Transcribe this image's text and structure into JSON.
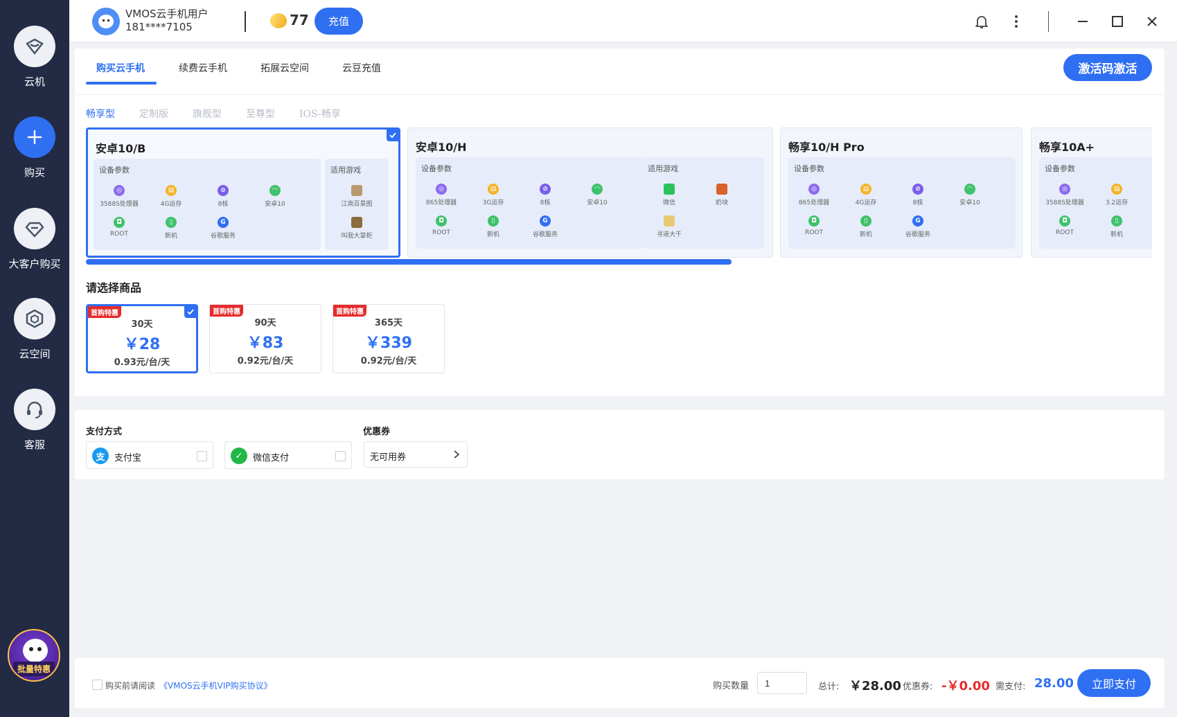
{
  "sidebar": {
    "items": [
      {
        "label": "云机",
        "icon": "cloud-phone-icon"
      },
      {
        "label": "购买",
        "icon": "plus-icon"
      },
      {
        "label": "大客户购买",
        "icon": "diamond-icon"
      },
      {
        "label": "云空间",
        "icon": "cube-icon"
      },
      {
        "label": "客服",
        "icon": "headset-icon"
      }
    ],
    "promo_label": "批量特惠"
  },
  "header": {
    "user_name": "VMOS云手机用户",
    "user_phone": "181****7105",
    "bean_count": "77",
    "recharge_label": "充值"
  },
  "tabs": [
    {
      "label": "购买云手机"
    },
    {
      "label": "续费云手机"
    },
    {
      "label": "拓展云空间"
    },
    {
      "label": "云豆充值"
    }
  ],
  "activate_label": "激活码激活",
  "subtabs": [
    {
      "label": "畅享型"
    },
    {
      "label": "定制版"
    },
    {
      "label": "旗舰型"
    },
    {
      "label": "至尊型"
    },
    {
      "label": "IOS-畅享"
    }
  ],
  "products": [
    {
      "title": "安卓10/B",
      "spec_title": "设备参数",
      "specs": [
        "3588S处理器",
        "4G运存",
        "8核",
        "安卓10",
        "ROOT",
        "新机",
        "谷歌服务"
      ],
      "games_title": "适用游戏",
      "games": [
        "江南百景图",
        "叫我大掌柜"
      ]
    },
    {
      "title": "安卓10/H",
      "spec_title": "设备参数",
      "specs": [
        "865处理器",
        "3G运存",
        "8核",
        "安卓10",
        "ROOT",
        "新机",
        "谷歌服务"
      ],
      "games_title": "适用游戏",
      "games": [
        "微信",
        "奶块",
        "寻道大千"
      ]
    },
    {
      "title": "畅享10/H Pro",
      "spec_title": "设备参数",
      "specs": [
        "865处理器",
        "4G运存",
        "8核",
        "安卓10",
        "ROOT",
        "新机",
        "谷歌服务"
      ]
    },
    {
      "title": "畅享10A+",
      "spec_title": "设备参数",
      "specs": [
        "3588S处理器",
        "3.2运存",
        "ROOT",
        "新机"
      ]
    }
  ],
  "select_title": "请选择商品",
  "packages": [
    {
      "badge": "首购特惠",
      "days": "30天",
      "price": "￥28",
      "per": "0.93元/台/天"
    },
    {
      "badge": "首购特惠",
      "days": "90天",
      "price": "￥83",
      "per": "0.92元/台/天"
    },
    {
      "badge": "首购特惠",
      "days": "365天",
      "price": "￥339",
      "per": "0.92元/台/天"
    }
  ],
  "payment": {
    "title": "支付方式",
    "alipay": "支付宝",
    "wechat": "微信支付",
    "coupon_title": "优惠券",
    "coupon_value": "无可用券"
  },
  "footer": {
    "agree_text": "购买前请阅读",
    "agree_link": "《VMOS云手机VIP购买协议》",
    "qty_label": "购买数量",
    "qty_value": "1",
    "total_label": "总计:",
    "total_value": "￥28.00",
    "coupon_label": "优惠券:",
    "coupon_value": "-￥0.00",
    "need_label": "需支付:",
    "need_value": "28.00",
    "pay_label": "立即支付"
  },
  "colors": {
    "accent": "#2f6ff2",
    "sidebar": "#222a44",
    "danger": "#e62b2b"
  }
}
